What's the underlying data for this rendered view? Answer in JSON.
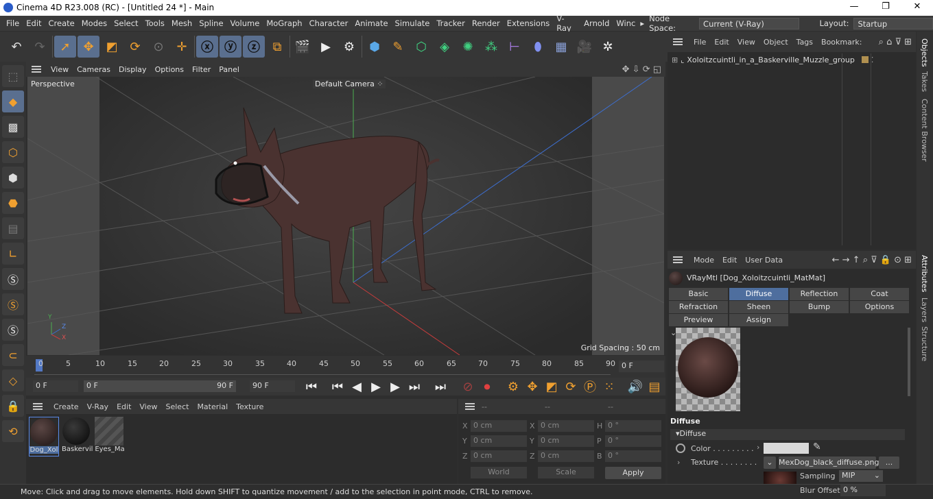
{
  "window": {
    "title": "Cinema 4D R23.008 (RC) - [Untitled 24 *] - Main",
    "min": "—",
    "max": "❐",
    "close": "✕"
  },
  "menu": [
    "File",
    "Edit",
    "Create",
    "Modes",
    "Select",
    "Tools",
    "Mesh",
    "Spline",
    "Volume",
    "MoGraph",
    "Character",
    "Animate",
    "Simulate",
    "Tracker",
    "Render",
    "Extensions",
    "V-Ray",
    "Arnold",
    "Winc"
  ],
  "nodespace": {
    "label": "Node Space:",
    "value": "Current (V-Ray)"
  },
  "layout": {
    "label": "Layout:",
    "value": "Startup"
  },
  "viewport": {
    "menu": [
      "View",
      "Cameras",
      "Display",
      "Options",
      "Filter",
      "Panel"
    ],
    "projection": "Perspective",
    "camera": "Default Camera",
    "grid_spacing": "Grid Spacing : 50 cm",
    "axis": {
      "y": "Y",
      "z": "Z",
      "x": "X"
    }
  },
  "timeline": {
    "ticks": [
      "0",
      "5",
      "10",
      "15",
      "20",
      "25",
      "30",
      "35",
      "40",
      "45",
      "50",
      "55",
      "60",
      "65",
      "70",
      "75",
      "80",
      "85",
      "90"
    ],
    "current": "0 F"
  },
  "transport": {
    "start": "0 F",
    "range_start": "0 F",
    "range_end": "90 F",
    "end": "90 F"
  },
  "matmgr": {
    "menu": [
      "Create",
      "V-Ray",
      "Edit",
      "View",
      "Select",
      "Material",
      "Texture"
    ],
    "materials": [
      {
        "name": "Dog_Xol"
      },
      {
        "name": "Baskervil"
      },
      {
        "name": "Eyes_Ma"
      }
    ]
  },
  "coord": {
    "header": [
      "--",
      "--",
      "--"
    ],
    "rows": [
      {
        "a": "X",
        "av": "0 cm",
        "b": "X",
        "bv": "0 cm",
        "c": "H",
        "cv": "0 °"
      },
      {
        "a": "Y",
        "av": "0 cm",
        "b": "Y",
        "bv": "0 cm",
        "c": "P",
        "cv": "0 °"
      },
      {
        "a": "Z",
        "av": "0 cm",
        "b": "Z",
        "bv": "0 cm",
        "c": "B",
        "cv": "0 °"
      }
    ],
    "world": "World",
    "scale": "Scale",
    "apply": "Apply"
  },
  "objmgr": {
    "menu": [
      "File",
      "Edit",
      "View",
      "Object",
      "Tags",
      "Bookmark:"
    ],
    "object": "Xoloitzcuintli_in_a_Baskerville_Muzzle_group"
  },
  "attr": {
    "menu": [
      "Mode",
      "Edit",
      "User Data"
    ],
    "material": "VRayMtl [Dog_Xoloitzcuintli_MatMat]",
    "tabs": [
      "Basic",
      "Diffuse",
      "Reflection",
      "Coat",
      "Refraction",
      "Sheen",
      "Bump",
      "Options",
      "Preview Settings",
      "Assign"
    ],
    "section": "Diffuse",
    "group": "Diffuse",
    "color_label": "Color . . . . . . . . .",
    "texture_label": "Texture . . . . . . . .",
    "texture_file": "MexDog_black_diffuse.png",
    "more": "...",
    "sampling_label": "Sampling",
    "sampling_value": "MIP",
    "blur_label": "Blur Offset",
    "blur_value": "0 %"
  },
  "sidetabs": [
    "Objects",
    "Takes",
    "Content Browser",
    "Attributes",
    "Layers",
    "Structure"
  ],
  "status": "Move: Click and drag to move elements. Hold down SHIFT to quantize movement / add to the selection in point mode, CTRL to remove."
}
